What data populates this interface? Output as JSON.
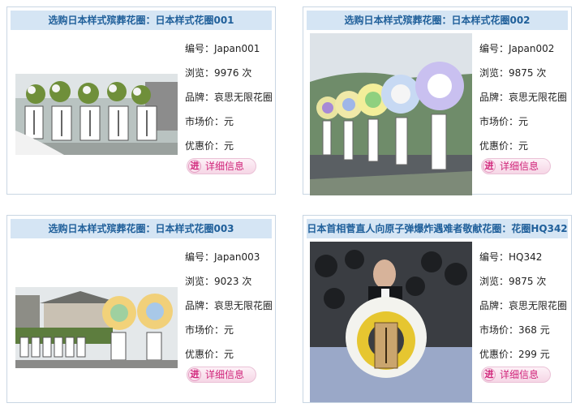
{
  "products": [
    {
      "title": "选购日本样式殡葬花圈：日本样式花圈001",
      "code": "编号：Japan001",
      "views": "浏览：9976 次",
      "brand": "品牌：哀思无限花圈",
      "market_price": "市场价：元",
      "sale_price": "优惠价：元",
      "btn_icon": "进",
      "btn_label": "详细信息"
    },
    {
      "title": "选购日本样式殡葬花圈：日本样式花圈002",
      "code": "编号：Japan002",
      "views": "浏览：9875 次",
      "brand": "品牌：哀思无限花圈",
      "market_price": "市场价：元",
      "sale_price": "优惠价：元",
      "btn_icon": "进",
      "btn_label": "详细信息"
    },
    {
      "title": "选购日本样式殡葬花圈：日本样式花圈003",
      "code": "编号：Japan003",
      "views": "浏览：9023 次",
      "brand": "品牌：哀思无限花圈",
      "market_price": "市场价：元",
      "sale_price": "优惠价：元",
      "btn_icon": "进",
      "btn_label": "详细信息"
    },
    {
      "title": "日本首相菅直人向原子弹爆炸遇难者敬献花圈：花圈HQ342",
      "code": "编号：HQ342",
      "views": "浏览：9875 次",
      "brand": "品牌：哀思无限花圈",
      "market_price": "市场价：368 元",
      "sale_price": "优惠价：299 元",
      "btn_icon": "进",
      "btn_label": "详细信息"
    }
  ],
  "colors": {
    "title_bg": "#d5e5f4",
    "title_text": "#1f5f9a",
    "button_text": "#d0247a",
    "border": "#c9d6e3"
  }
}
